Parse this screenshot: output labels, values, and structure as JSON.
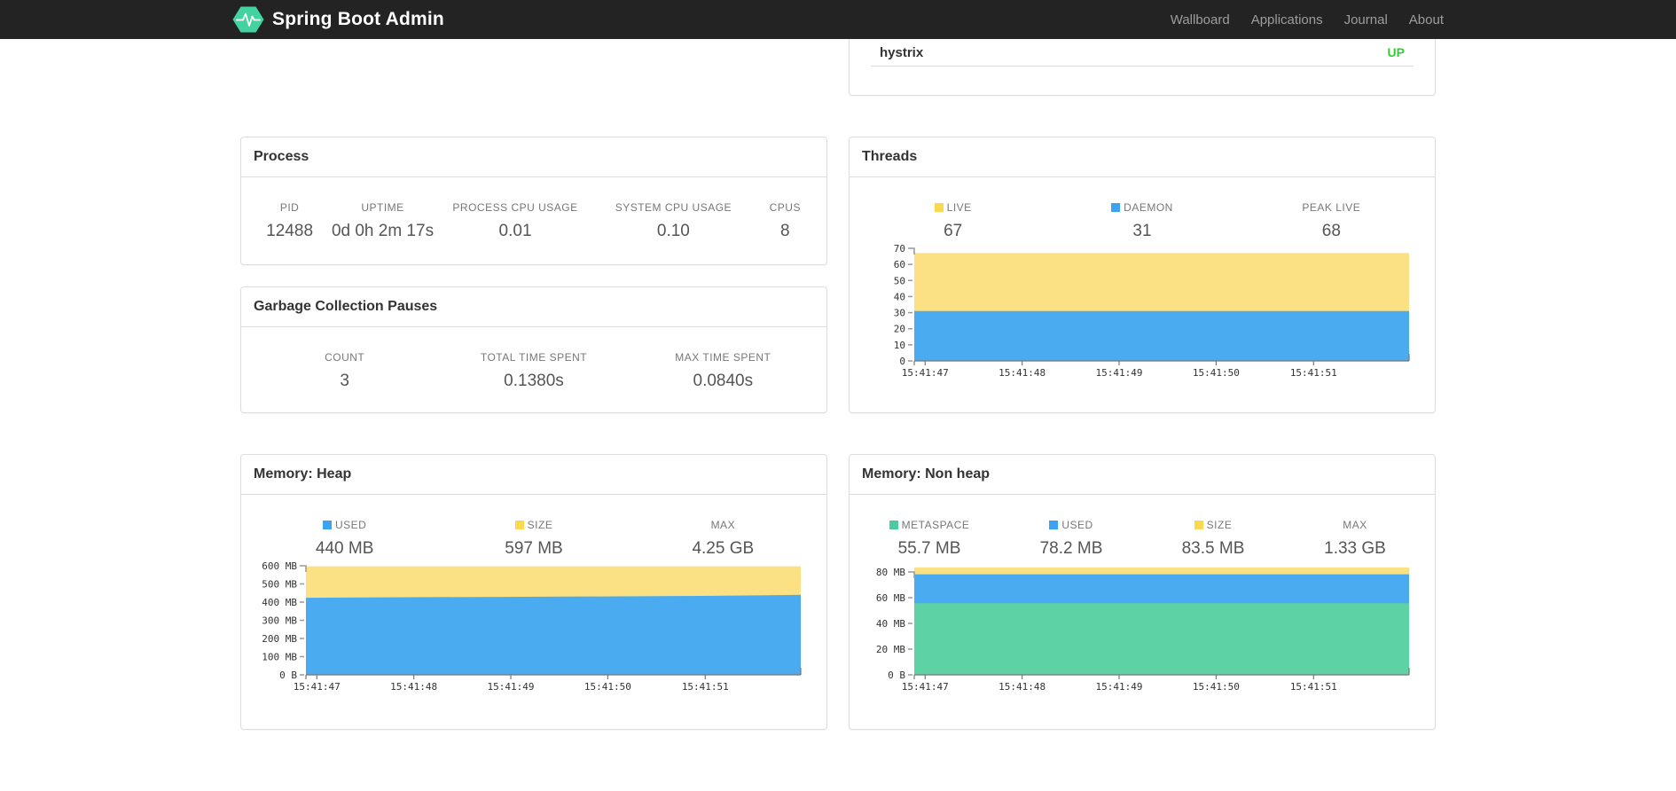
{
  "navbar": {
    "brand": "Spring Boot Admin",
    "logo_color": "#42d3a1",
    "links": [
      {
        "label": "Wallboard"
      },
      {
        "label": "Applications"
      },
      {
        "label": "Journal"
      },
      {
        "label": "About"
      }
    ]
  },
  "status_panel": {
    "application": "hystrix",
    "status": "UP",
    "status_color": "#33cc33"
  },
  "panels": {
    "process": {
      "title": "Process",
      "metrics": [
        {
          "key": "pid",
          "label": "PID",
          "value": "12488"
        },
        {
          "key": "uptime",
          "label": "UPTIME",
          "value": "0d 0h 2m 17s"
        },
        {
          "key": "process-cpu-usage",
          "label": "PROCESS CPU USAGE",
          "value": "0.01"
        },
        {
          "key": "system-cpu-usage",
          "label": "SYSTEM CPU USAGE",
          "value": "0.10"
        },
        {
          "key": "cpus",
          "label": "CPUS",
          "value": "8"
        }
      ]
    },
    "gc": {
      "title": "Garbage Collection Pauses",
      "metrics": [
        {
          "key": "count",
          "label": "COUNT",
          "value": "3"
        },
        {
          "key": "total-time-spent",
          "label": "TOTAL TIME SPENT",
          "value": "0.1380s"
        },
        {
          "key": "max-time-spent",
          "label": "MAX TIME SPENT",
          "value": "0.0840s"
        }
      ]
    },
    "threads": {
      "title": "Threads",
      "metrics": [
        {
          "key": "live",
          "label": "LIVE",
          "value": "67",
          "swatch": "#fbd94f"
        },
        {
          "key": "daemon",
          "label": "DAEMON",
          "value": "31",
          "swatch": "#3ba3ef"
        },
        {
          "key": "peak-live",
          "label": "PEAK LIVE",
          "value": "68"
        }
      ]
    },
    "heap": {
      "title": "Memory: Heap",
      "metrics": [
        {
          "key": "used",
          "label": "USED",
          "value": "440 MB",
          "swatch": "#3ba3ef"
        },
        {
          "key": "size",
          "label": "SIZE",
          "value": "597 MB",
          "swatch": "#fbd94f"
        },
        {
          "key": "max",
          "label": "MAX",
          "value": "4.25 GB"
        }
      ]
    },
    "nonheap": {
      "title": "Memory: Non heap",
      "metrics": [
        {
          "key": "metaspace",
          "label": "METASPACE",
          "value": "55.7 MB",
          "swatch": "#4ccc9c"
        },
        {
          "key": "used",
          "label": "USED",
          "value": "78.2 MB",
          "swatch": "#3ba3ef"
        },
        {
          "key": "size",
          "label": "SIZE",
          "value": "83.5 MB",
          "swatch": "#fbd94f"
        },
        {
          "key": "max",
          "label": "MAX",
          "value": "1.33 GB"
        }
      ]
    }
  },
  "chart_data": [
    {
      "type": "area",
      "title": "Threads",
      "stacked_overlay": true,
      "x_ticks": [
        "15:41:47",
        "15:41:48",
        "15:41:49",
        "15:41:50",
        "15:41:51"
      ],
      "ylim": [
        0,
        70
      ],
      "y_ticks": [
        [
          0,
          "0"
        ],
        [
          10,
          "10"
        ],
        [
          20,
          "20"
        ],
        [
          30,
          "30"
        ],
        [
          40,
          "40"
        ],
        [
          50,
          "50"
        ],
        [
          60,
          "60"
        ],
        [
          70,
          "70"
        ]
      ],
      "series": [
        {
          "name": "LIVE",
          "color": "#fbe183",
          "values": [
            67,
            67,
            67,
            67,
            67,
            67
          ]
        },
        {
          "name": "DAEMON",
          "color": "#4aabf0",
          "values": [
            31,
            31,
            31,
            31,
            31,
            31
          ]
        }
      ],
      "legend_position": "top",
      "grid": false
    },
    {
      "type": "area",
      "title": "Memory: Heap",
      "stacked_overlay": true,
      "x_ticks": [
        "15:41:47",
        "15:41:48",
        "15:41:49",
        "15:41:50",
        "15:41:51"
      ],
      "ylim": [
        0,
        600
      ],
      "y_ticks": [
        [
          0,
          "0 B"
        ],
        [
          100,
          "100 MB"
        ],
        [
          200,
          "200 MB"
        ],
        [
          300,
          "300 MB"
        ],
        [
          400,
          "400 MB"
        ],
        [
          500,
          "500 MB"
        ],
        [
          600,
          "600 MB"
        ]
      ],
      "series": [
        {
          "name": "SIZE",
          "color": "#fbe183",
          "values": [
            597,
            597,
            597,
            597,
            597,
            597
          ]
        },
        {
          "name": "USED",
          "color": "#4aabf0",
          "values": [
            424,
            427,
            429,
            431,
            434,
            440
          ]
        }
      ],
      "legend_position": "top",
      "grid": false
    },
    {
      "type": "area",
      "title": "Memory: Non heap",
      "stacked_overlay": true,
      "x_ticks": [
        "15:41:47",
        "15:41:48",
        "15:41:49",
        "15:41:50",
        "15:41:51"
      ],
      "ylim": [
        0,
        80
      ],
      "y_ticks": [
        [
          0,
          "0 B"
        ],
        [
          20,
          "20 MB"
        ],
        [
          40,
          "40 MB"
        ],
        [
          60,
          "60 MB"
        ],
        [
          80,
          "80 MB"
        ]
      ],
      "series": [
        {
          "name": "SIZE",
          "color": "#fbe183",
          "values": [
            83.5,
            83.5,
            83.5,
            83.5,
            83.5,
            83.5
          ]
        },
        {
          "name": "USED",
          "color": "#4aabf0",
          "values": [
            78.2,
            78.2,
            78.2,
            78.2,
            78.2,
            78.2
          ]
        },
        {
          "name": "METASPACE",
          "color": "#5cd2a5",
          "values": [
            55.7,
            55.7,
            55.7,
            55.7,
            55.7,
            55.7
          ]
        }
      ],
      "legend_position": "top",
      "grid": false
    }
  ]
}
